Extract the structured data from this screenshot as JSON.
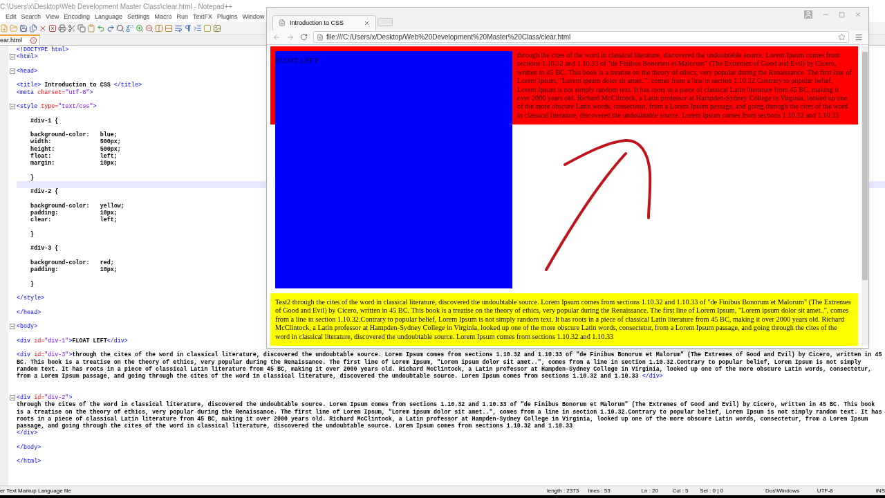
{
  "notepad": {
    "title": "C:\\Users\\x\\Desktop\\Web Development Master Class\\clear.html - Notepad++",
    "menu": [
      "Edit",
      "Search",
      "View",
      "Encoding",
      "Language",
      "Settings",
      "Macro",
      "Run",
      "TextFX",
      "Plugins",
      "Window"
    ],
    "tab": {
      "label": "ear.html"
    },
    "editor": {
      "lines": [
        {
          "kind": "code",
          "text": "<!DOCTYPE html>",
          "folder": false,
          "current": false
        },
        {
          "kind": "code",
          "text": "<html>",
          "folder": true,
          "current": false
        },
        {
          "kind": "blank",
          "folder": false,
          "current": false
        },
        {
          "kind": "code",
          "text": "<head>",
          "folder": true,
          "current": false
        },
        {
          "kind": "blank",
          "folder": false,
          "current": false
        },
        {
          "kind": "code",
          "text": "<title> Introduction to CSS </title>",
          "folder": false,
          "current": false
        },
        {
          "kind": "code",
          "text": "<meta charset=\"utf-8\">",
          "folder": false,
          "current": false
        },
        {
          "kind": "blank",
          "folder": false,
          "current": false
        },
        {
          "kind": "code",
          "text": "<style type=\"text/css\">",
          "folder": true,
          "current": false
        },
        {
          "kind": "blank",
          "folder": false,
          "current": false
        },
        {
          "kind": "code",
          "text": "    #div-1 {",
          "folder": false,
          "current": false
        },
        {
          "kind": "blank",
          "folder": false,
          "current": false
        },
        {
          "kind": "code",
          "text": "    background-color:   blue;",
          "folder": false,
          "current": false
        },
        {
          "kind": "code",
          "text": "    width:              500px;",
          "folder": false,
          "current": false
        },
        {
          "kind": "code",
          "text": "    height:             500px;",
          "folder": false,
          "current": false
        },
        {
          "kind": "code",
          "text": "    float:              left;",
          "folder": false,
          "current": false
        },
        {
          "kind": "code",
          "text": "    margin:             10px;",
          "folder": false,
          "current": false
        },
        {
          "kind": "blank",
          "folder": false,
          "current": false
        },
        {
          "kind": "code",
          "text": "    }",
          "folder": false,
          "current": false
        },
        {
          "kind": "blank",
          "folder": false,
          "current": true
        },
        {
          "kind": "code",
          "text": "    #div-2 {",
          "folder": false,
          "current": false
        },
        {
          "kind": "blank",
          "folder": false,
          "current": false
        },
        {
          "kind": "code",
          "text": "    background-color:   yellow;",
          "folder": false,
          "current": false
        },
        {
          "kind": "code",
          "text": "    padding:            10px;",
          "folder": false,
          "current": false
        },
        {
          "kind": "code",
          "text": "    clear:              left;",
          "folder": false,
          "current": false
        },
        {
          "kind": "blank",
          "folder": false,
          "current": false
        },
        {
          "kind": "code",
          "text": "    }",
          "folder": false,
          "current": false
        },
        {
          "kind": "blank",
          "folder": false,
          "current": false
        },
        {
          "kind": "code",
          "text": "    #div-3 {",
          "folder": false,
          "current": false
        },
        {
          "kind": "blank",
          "folder": false,
          "current": false
        },
        {
          "kind": "code",
          "text": "    background-color:   red;",
          "folder": false,
          "current": false
        },
        {
          "kind": "code",
          "text": "    padding:            10px;",
          "folder": false,
          "current": false
        },
        {
          "kind": "blank",
          "folder": false,
          "current": false
        },
        {
          "kind": "code",
          "text": "    }",
          "folder": false,
          "current": false
        },
        {
          "kind": "blank",
          "folder": false,
          "current": false
        },
        {
          "kind": "code",
          "text": "</style>",
          "folder": false,
          "current": false
        },
        {
          "kind": "blank",
          "folder": false,
          "current": false
        },
        {
          "kind": "code",
          "text": "</head>",
          "folder": false,
          "current": false
        },
        {
          "kind": "blank",
          "folder": false,
          "current": false
        },
        {
          "kind": "code",
          "text": "<body>",
          "folder": true,
          "current": false
        },
        {
          "kind": "blank",
          "folder": false,
          "current": false
        },
        {
          "kind": "code",
          "text": "<div id=\"div-1\">FLOAT LEFT</div>",
          "folder": false,
          "current": false
        },
        {
          "kind": "blank",
          "folder": false,
          "current": false
        },
        {
          "kind": "code",
          "text": "<div id=\"div-3\">through the cites of the word in classical literature, discovered the undoubtable source. Lorem Ipsum comes from sections 1.10.32 and 1.10.33 of \"de Finibus Bonorum et Malorum\" (The Extremes of Good and Evil) by Cicero, written in 45 BC. This book is a treatise on the theory of ethics, very popular during the Renaissance. The first line of Lorem Ipsum, \"Lorem ipsum dolor sit amet..\", comes from a line in section 1.10.32.Contrary to popular belief, Lorem Ipsum is not simply random text. It has roots in a piece of classical Latin literature from 45 BC, making it over 2000 years old. Richard McClintock, a Latin professor at Hampden-Sydney College in Virginia, looked up one of the more obscure Latin words, consectetur, from a Lorem Ipsum passage, and going through the cites of the word in classical literature, discovered the undoubtable source. Lorem Ipsum comes from sections 1.10.32 and 1.10.33 </div>",
          "folder": false,
          "current": false
        },
        {
          "kind": "blank",
          "folder": false,
          "current": false
        },
        {
          "kind": "blank",
          "folder": false,
          "current": false
        },
        {
          "kind": "code",
          "text": "<div id=\"div-2\">",
          "folder": true,
          "current": false
        },
        {
          "kind": "code",
          "text": "through the cites of the word in classical literature, discovered the undoubtable source. Lorem Ipsum comes from sections 1.10.32 and 1.10.33 of \"de Finibus Bonorum et Malorum\" (The Extremes of Good and Evil) by Cicero, written in 45 BC. This book is a treatise on the theory of ethics, very popular during the Renaissance. The first line of Lorem Ipsum, \"Lorem ipsum dolor sit amet..\", comes from a line in section 1.10.32.Contrary to popular belief, Lorem Ipsum is not simply random text. It has roots in a piece of classical Latin literature from 45 BC, making it over 2000 years old. Richard McClintock, a Latin professor at Hampden-Sydney College in Virginia, looked up one of the more obscure Latin words, consectetur, from a Lorem Ipsum passage, and going through the cites of the word in classical literature, discovered the undoubtable source. Lorem Ipsum comes from sections 1.10.32 and 1.10.33",
          "folder": false,
          "current": false
        },
        {
          "kind": "code",
          "text": "</div>",
          "folder": false,
          "current": false
        },
        {
          "kind": "blank",
          "folder": false,
          "current": false
        },
        {
          "kind": "code",
          "text": "</body>",
          "folder": false,
          "current": false
        },
        {
          "kind": "blank",
          "folder": false,
          "current": false
        },
        {
          "kind": "code",
          "text": "</html>",
          "folder": false,
          "current": false
        }
      ]
    },
    "status_bar": {
      "file_type": "er Text Markup Language file",
      "length": "length : 2373",
      "lines": "lines : 53",
      "line": "Ln : 20",
      "column": "Col : 5",
      "selection": "Sel : 0 | 0",
      "eol": "Dos\\Windows",
      "encoding": "UTF-8",
      "mode": "INS"
    }
  },
  "browser": {
    "tab": {
      "title": "Introduction to CSS"
    },
    "url": "file:///C:/Users/x/Desktop/Web%20Development%20Master%20Class/clear.html",
    "page": {
      "div_1": "FLOAT LEFT",
      "div_3": "through the cites of the word in classical literature, discovered the undoubtable source. Lorem Ipsum comes from sections 1.10.32 and 1.10.33 of \"de Finibus Bonorum et Malorum\" (The Extremes of Good and Evil) by Cicero, written in 45 BC. This book is a treatise on the theory of ethics, very popular during the Renaissance. The first line of Lorem Ipsum, \"Lorem ipsum dolor sit amet..\", comes from a line in section 1.10.32.Contrary to popular belief, Lorem Ipsum is not simply random text. It has roots in a piece of classical Latin literature from 45 BC, making it over 2000 years old. Richard McClintock, a Latin professor at Hampden-Sydney College in Virginia, looked up one of the more obscure Latin words, consectetur, from a Lorem Ipsum passage, and going through the cites of the word in classical literature, discovered the undoubtable source. Lorem Ipsum comes from sections 1.10.32 and 1.10.33",
      "div_2": "Test2 through the cites of the word in classical literature, discovered the undoubtable source. Lorem Ipsum comes from sections 1.10.32 and 1.10.33 of \"de Finibus Bonorum et Malorum\" (The Extremes of Good and Evil) by Cicero, written in 45 BC. This book is a treatise on the theory of ethics, very popular during the Renaissance. The first line of Lorem Ipsum, \"Lorem ipsum dolor sit amet..\", comes from a line in section 1.10.32.Contrary to popular belief, Lorem Ipsum is not simply random text. It has roots in a piece of classical Latin literature from 45 BC, making it over 2000 years old. Richard McClintock, a Latin professor at Hampden-Sydney College in Virginia, looked up one of the more obscure Latin words, consectetur, from a Lorem Ipsum passage, and going through the cites of the word in classical literature, discovered the undoubtable source. Lorem Ipsum comes from sections 1.10.32 and 1.10.33"
    }
  }
}
